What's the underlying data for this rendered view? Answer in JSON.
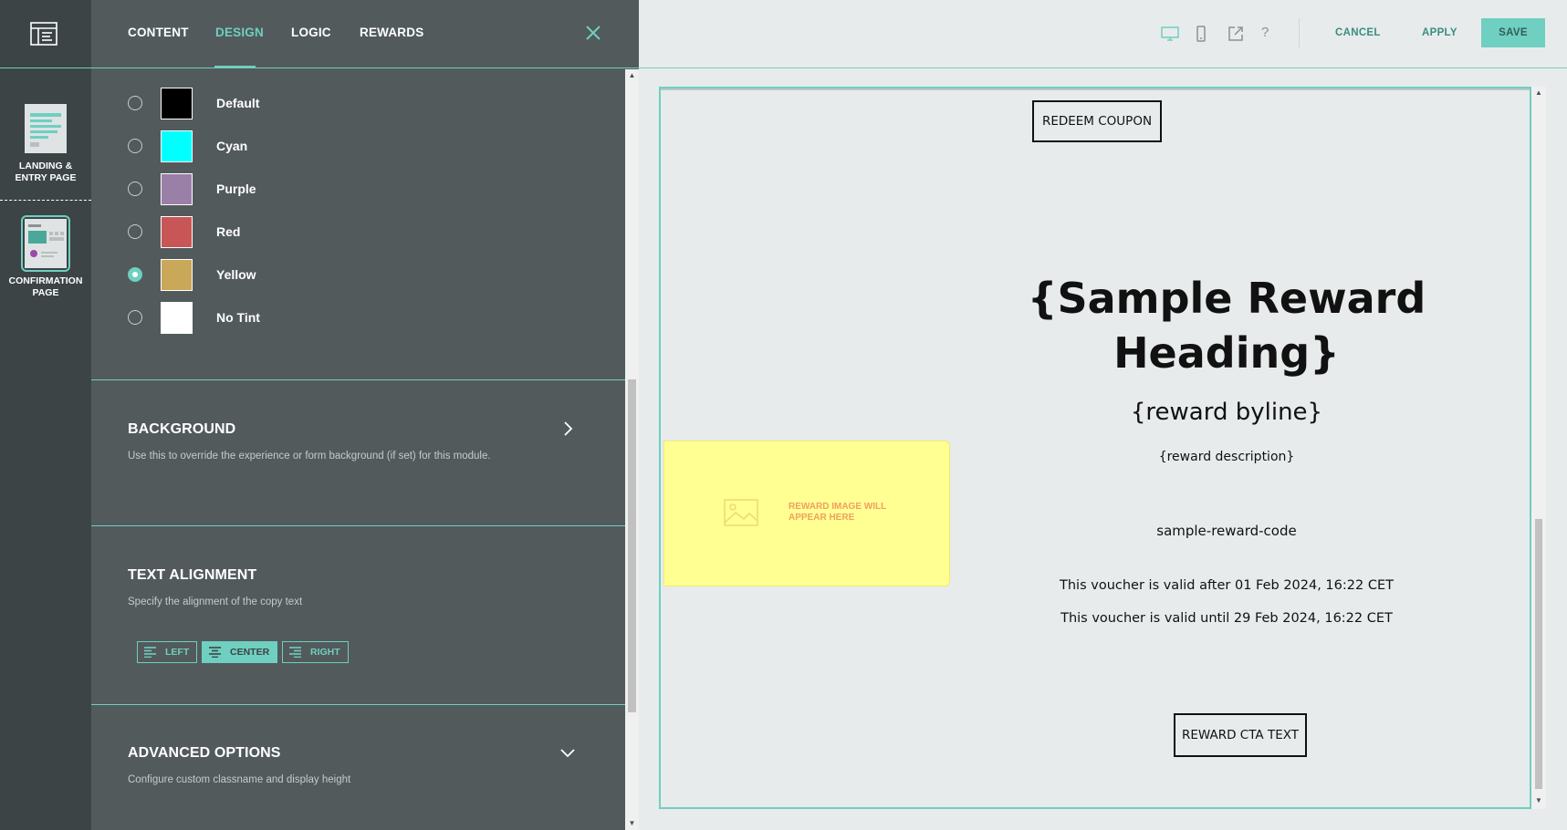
{
  "rail": {
    "pages": [
      {
        "label_line1": "LANDING &",
        "label_line2": "ENTRY PAGE"
      },
      {
        "label_line1": "CONFIRMATION",
        "label_line2": "PAGE"
      }
    ]
  },
  "panel": {
    "tabs": [
      "CONTENT",
      "DESIGN",
      "LOGIC",
      "REWARDS"
    ],
    "active_tab": "DESIGN",
    "tints": [
      {
        "label": "Default",
        "color": "#000000",
        "checked": false
      },
      {
        "label": "Cyan",
        "color": "#00ffff",
        "checked": false
      },
      {
        "label": "Purple",
        "color": "#9a7fa6",
        "checked": false
      },
      {
        "label": "Red",
        "color": "#c95656",
        "checked": false
      },
      {
        "label": "Yellow",
        "color": "#c9a85a",
        "checked": true
      },
      {
        "label": "No Tint",
        "color": "#ffffff",
        "checked": false
      }
    ],
    "background": {
      "title": "BACKGROUND",
      "desc": "Use this to override the experience or form background (if set) for this module."
    },
    "text_alignment": {
      "title": "TEXT ALIGNMENT",
      "desc": "Specify the alignment of the copy text",
      "buttons": [
        "LEFT",
        "CENTER",
        "RIGHT"
      ],
      "selected": "CENTER"
    },
    "advanced": {
      "title": "ADVANCED OPTIONS",
      "desc": "Configure custom classname and display height"
    }
  },
  "toolbar": {
    "cancel": "CANCEL",
    "apply": "APPLY",
    "save": "SAVE",
    "help": "?"
  },
  "preview": {
    "redeem_button": "REDEEM COUPON",
    "heading": "{Sample Reward Heading}",
    "byline": "{reward byline}",
    "description": "{reward description}",
    "code": "sample-reward-code",
    "valid_after": "This voucher is valid after 01 Feb 2024, 16:22 CET",
    "valid_until": "This voucher is valid until 29 Feb 2024, 16:22 CET",
    "cta": "REWARD CTA TEXT",
    "image_placeholder": "REWARD IMAGE WILL APPEAR HERE"
  },
  "colors": {
    "accent": "#6fcfc0",
    "rail": "#3c4446",
    "panel": "#525a5c",
    "preview_bg": "#e8ebec",
    "placeholder": "#ffff92"
  }
}
